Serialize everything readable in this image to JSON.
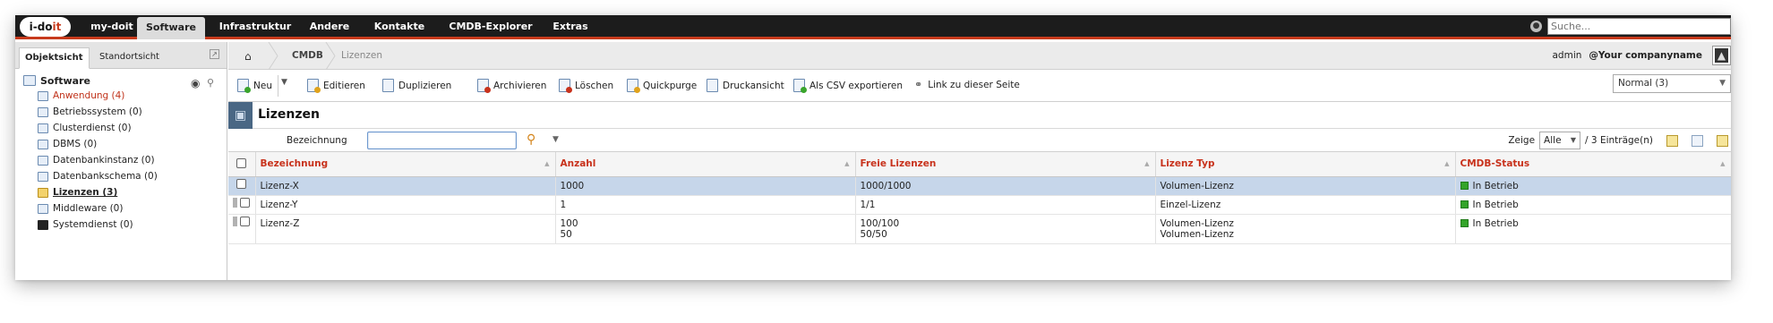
{
  "logo": {
    "text_left": "i-do",
    "text_right": "it"
  },
  "topnav": {
    "items": [
      {
        "label": "my-doit"
      },
      {
        "label": "Software"
      },
      {
        "label": "Infrastruktur"
      },
      {
        "label": "Andere"
      },
      {
        "label": "Kontakte"
      },
      {
        "label": "CMDB-Explorer"
      },
      {
        "label": "Extras"
      }
    ],
    "search_placeholder": "Suche..."
  },
  "left": {
    "tabs": [
      {
        "label": "Objektsicht"
      },
      {
        "label": "Standortsicht"
      }
    ],
    "root": "Software",
    "items": [
      {
        "label": "Anwendung (4)"
      },
      {
        "label": "Betriebssystem (0)"
      },
      {
        "label": "Clusterdienst (0)"
      },
      {
        "label": "DBMS (0)"
      },
      {
        "label": "Datenbankinstanz (0)"
      },
      {
        "label": "Datenbankschema (0)"
      },
      {
        "label": "Lizenzen (3)"
      },
      {
        "label": "Middleware (0)"
      },
      {
        "label": "Systemdienst (0)"
      }
    ]
  },
  "breadcrumb": {
    "cmdb": "CMDB",
    "current": "Lizenzen"
  },
  "user": {
    "name": "admin",
    "company": "@Your companyname"
  },
  "toolbar": {
    "new": "Neu",
    "edit": "Editieren",
    "duplicate": "Duplizieren",
    "archive": "Archivieren",
    "delete": "Löschen",
    "quickpurge": "Quickpurge",
    "print": "Druckansicht",
    "csv": "Als CSV exportieren",
    "link": "Link zu dieser Seite",
    "view": "Normal (3)"
  },
  "object": {
    "title": "Lizenzen"
  },
  "filter": {
    "label": "Bezeichnung",
    "value": ""
  },
  "paging": {
    "show_label": "Zeige",
    "show_value": "Alle",
    "count_label": "/ 3 Einträge(n)"
  },
  "table": {
    "columns": [
      "Bezeichnung",
      "Anzahl",
      "Freie Lizenzen",
      "Lizenz Typ",
      "CMDB-Status"
    ],
    "rows": [
      {
        "name": "Lizenz-X",
        "count": [
          "1000"
        ],
        "free": [
          "1000/1000"
        ],
        "type": [
          "Volumen-Lizenz"
        ],
        "status": "In Betrieb"
      },
      {
        "name": "Lizenz-Y",
        "count": [
          "1"
        ],
        "free": [
          "1/1"
        ],
        "type": [
          "Einzel-Lizenz"
        ],
        "status": "In Betrieb"
      },
      {
        "name": "Lizenz-Z",
        "count": [
          "100",
          "50"
        ],
        "free": [
          "100/100",
          "50/50"
        ],
        "type": [
          "Volumen-Lizenz",
          "Volumen-Lizenz"
        ],
        "status": "In Betrieb"
      }
    ]
  },
  "colors": {
    "accent": "#c73a1c",
    "status_ok": "#33a429",
    "row_highlight": "#c6d6ea"
  }
}
